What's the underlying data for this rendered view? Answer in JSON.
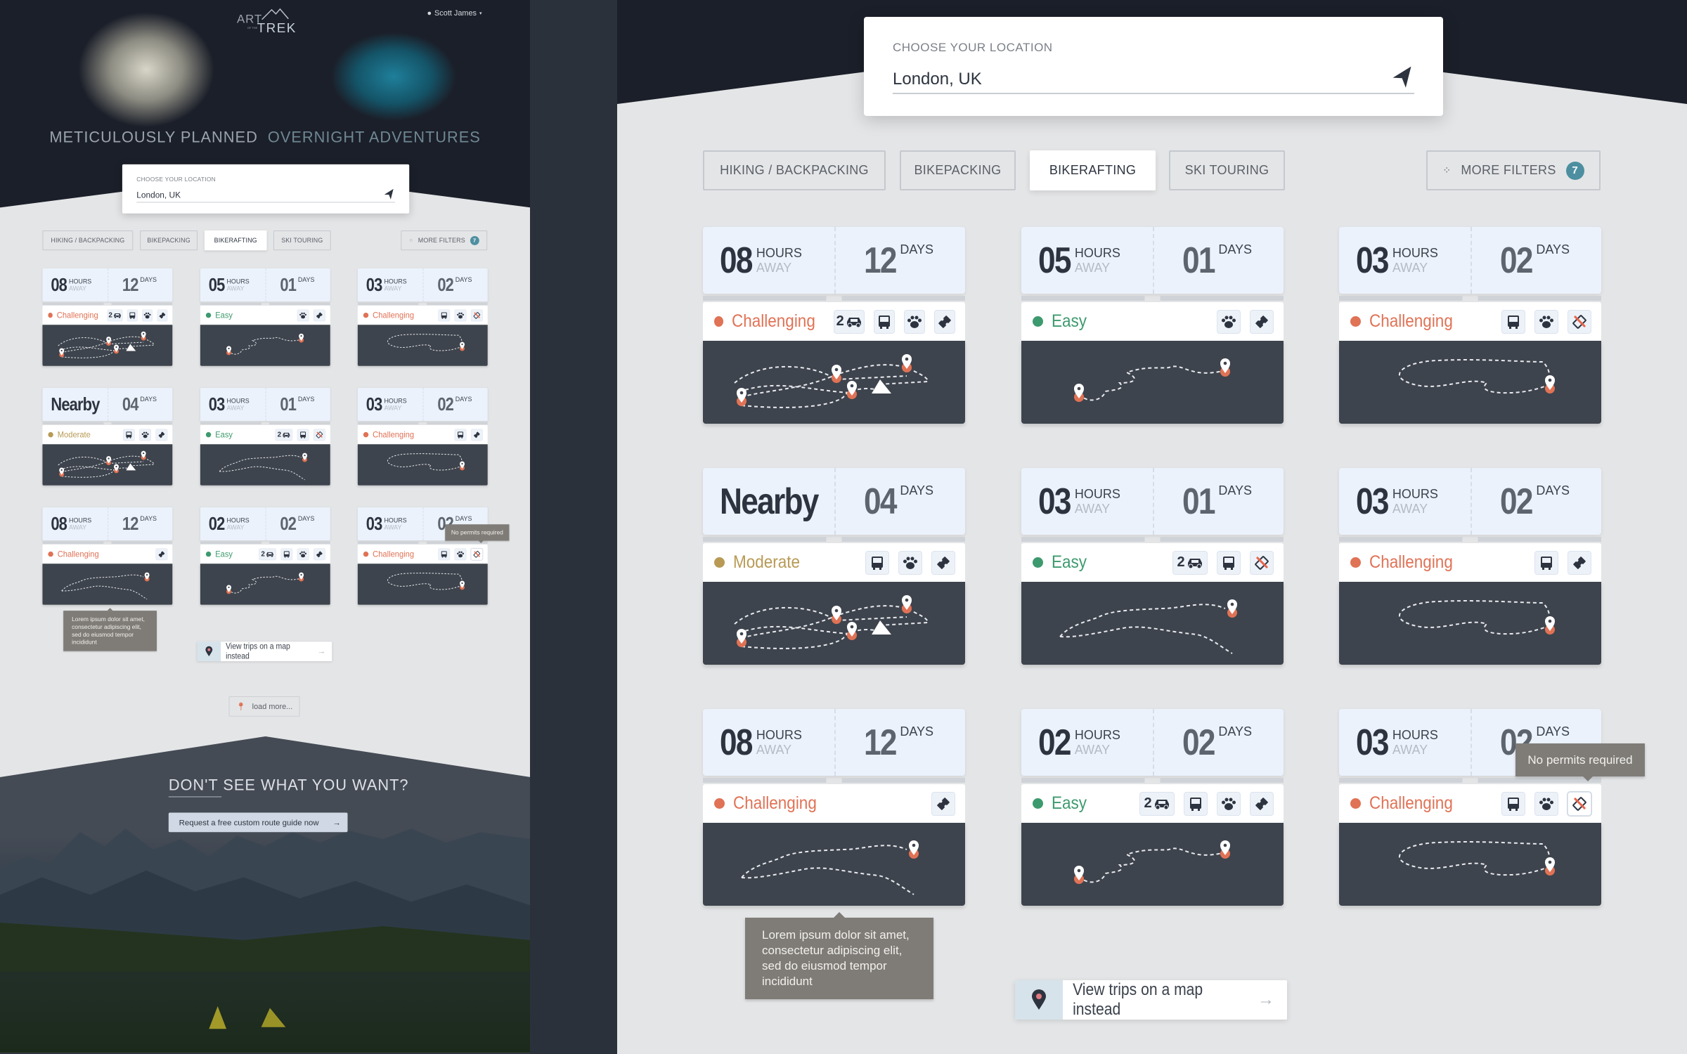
{
  "header": {
    "logo_text": "ART OF THE TREK",
    "user_name": "Scott James"
  },
  "hero": {
    "title_a": "METICULOUSLY PLANNED",
    "title_b": "OVERNIGHT ADVENTURES"
  },
  "location": {
    "label": "CHOOSE YOUR LOCATION",
    "value": "London, UK"
  },
  "tabs": [
    {
      "label": "HIKING / BACKPACKING",
      "active": false
    },
    {
      "label": "BIKEPACKING",
      "active": false
    },
    {
      "label": "BIKERAFTING",
      "active": true
    },
    {
      "label": "SKI TOURING",
      "active": false
    }
  ],
  "more_filters": {
    "label": "MORE FILTERS",
    "count": "7"
  },
  "labels": {
    "hours": "HOURS",
    "away": "AWAY",
    "days": "DAYS"
  },
  "difficulty_colors": {
    "Challenging": "#e07255",
    "Easy": "#3d9a6e",
    "Moderate": "#b89a55"
  },
  "cards": [
    {
      "hours": "08",
      "days": "12",
      "difficulty": "Challenging",
      "icons": [
        {
          "icon": "car",
          "count": "2"
        },
        {
          "icon": "bus"
        },
        {
          "icon": "paw"
        },
        {
          "icon": "ticket"
        }
      ],
      "route": "multi"
    },
    {
      "hours": "05",
      "days": "01",
      "difficulty": "Easy",
      "icons": [
        {
          "icon": "paw"
        },
        {
          "icon": "ticket"
        }
      ],
      "route": "zigzag"
    },
    {
      "hours": "03",
      "days": "02",
      "difficulty": "Challenging",
      "icons": [
        {
          "icon": "bus"
        },
        {
          "icon": "paw"
        },
        {
          "icon": "no-permit"
        }
      ],
      "route": "loop"
    },
    {
      "nearby": "Nearby",
      "days": "04",
      "difficulty": "Moderate",
      "icons": [
        {
          "icon": "bus"
        },
        {
          "icon": "paw"
        },
        {
          "icon": "ticket"
        }
      ],
      "route": "multi"
    },
    {
      "hours": "03",
      "days": "01",
      "difficulty": "Easy",
      "icons": [
        {
          "icon": "car",
          "count": "2"
        },
        {
          "icon": "bus"
        },
        {
          "icon": "no-permit"
        }
      ],
      "route": "wave"
    },
    {
      "hours": "03",
      "days": "02",
      "difficulty": "Challenging",
      "icons": [
        {
          "icon": "bus"
        },
        {
          "icon": "ticket"
        }
      ],
      "route": "loop"
    },
    {
      "hours": "08",
      "days": "12",
      "difficulty": "Challenging",
      "icons": [
        {
          "icon": "ticket"
        }
      ],
      "route": "wave"
    },
    {
      "hours": "02",
      "days": "02",
      "difficulty": "Easy",
      "icons": [
        {
          "icon": "car",
          "count": "2"
        },
        {
          "icon": "bus"
        },
        {
          "icon": "paw"
        },
        {
          "icon": "ticket"
        }
      ],
      "route": "zigzag"
    },
    {
      "hours": "03",
      "days": "02",
      "difficulty": "Challenging",
      "icons": [
        {
          "icon": "bus"
        },
        {
          "icon": "paw"
        },
        {
          "icon": "no-permit",
          "active": true
        }
      ],
      "route": "loop"
    }
  ],
  "tooltips": {
    "description": "Lorem ipsum dolor sit amet, consectetur adipiscing elit, sed do eiusmod tempor incididunt",
    "permit": "No permits required"
  },
  "map_button": {
    "label": "View trips on a map instead"
  },
  "load_more": {
    "label": "load more..."
  },
  "cta": {
    "title": "DON'T SEE WHAT YOU WANT?",
    "button": "Request a free custom route guide now"
  }
}
